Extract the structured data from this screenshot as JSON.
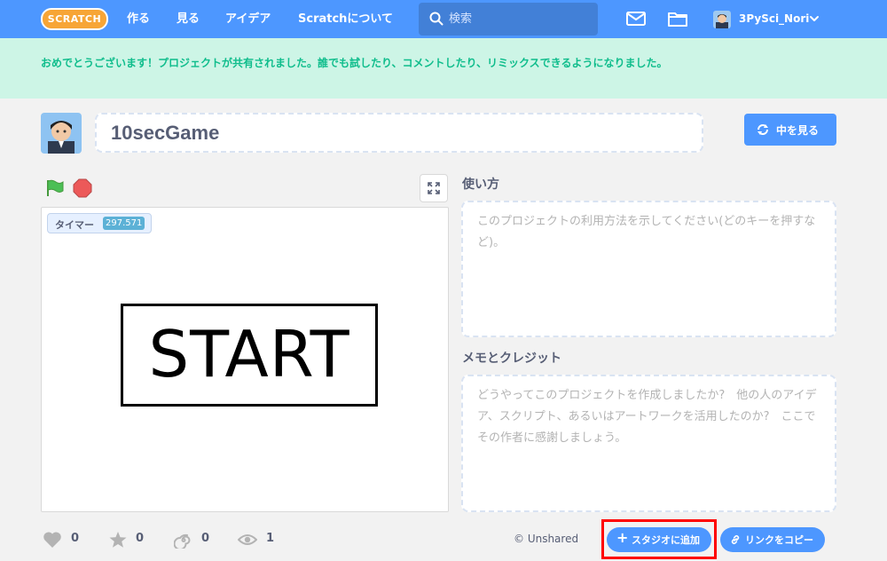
{
  "nav": {
    "logo": "SCRATCH",
    "create": "作る",
    "explore": "見る",
    "ideas": "アイデア",
    "about": "Scratchについて",
    "search_placeholder": "検索",
    "username": "3PySci_Nori"
  },
  "banner": {
    "message": "おめでとうございます！プロジェクトが共有されました。誰でも試したり、コメントしたり、リミックスできるようになりました。"
  },
  "project": {
    "title": "10secGame",
    "see_inside": "中を見る"
  },
  "stage": {
    "monitor_label": "タイマー",
    "monitor_value": "297.571",
    "start_text": "START"
  },
  "instructions": {
    "label": "使い方",
    "placeholder": "このプロジェクトの利用方法を示してください(どのキーを押すなど)。"
  },
  "notes": {
    "label": "メモとクレジット",
    "placeholder": "どうやってこのプロジェクトを作成しましたか?　他の人のアイデア、スクリプト、あるいはアートワークを活用したのか?　ここでその作者に感謝しましょう。"
  },
  "stats": {
    "loves": "0",
    "favorites": "0",
    "remixes": "0",
    "views": "1"
  },
  "footer": {
    "shared_status": "© Unshared",
    "add_to_studio": "スタジオに追加",
    "copy_link": "リンクをコピー"
  },
  "colors": {
    "brand_blue": "#4d97ff",
    "banner_bg": "#cdf5e6",
    "banner_text": "#0fbd8c",
    "highlight": "#ff0000"
  }
}
